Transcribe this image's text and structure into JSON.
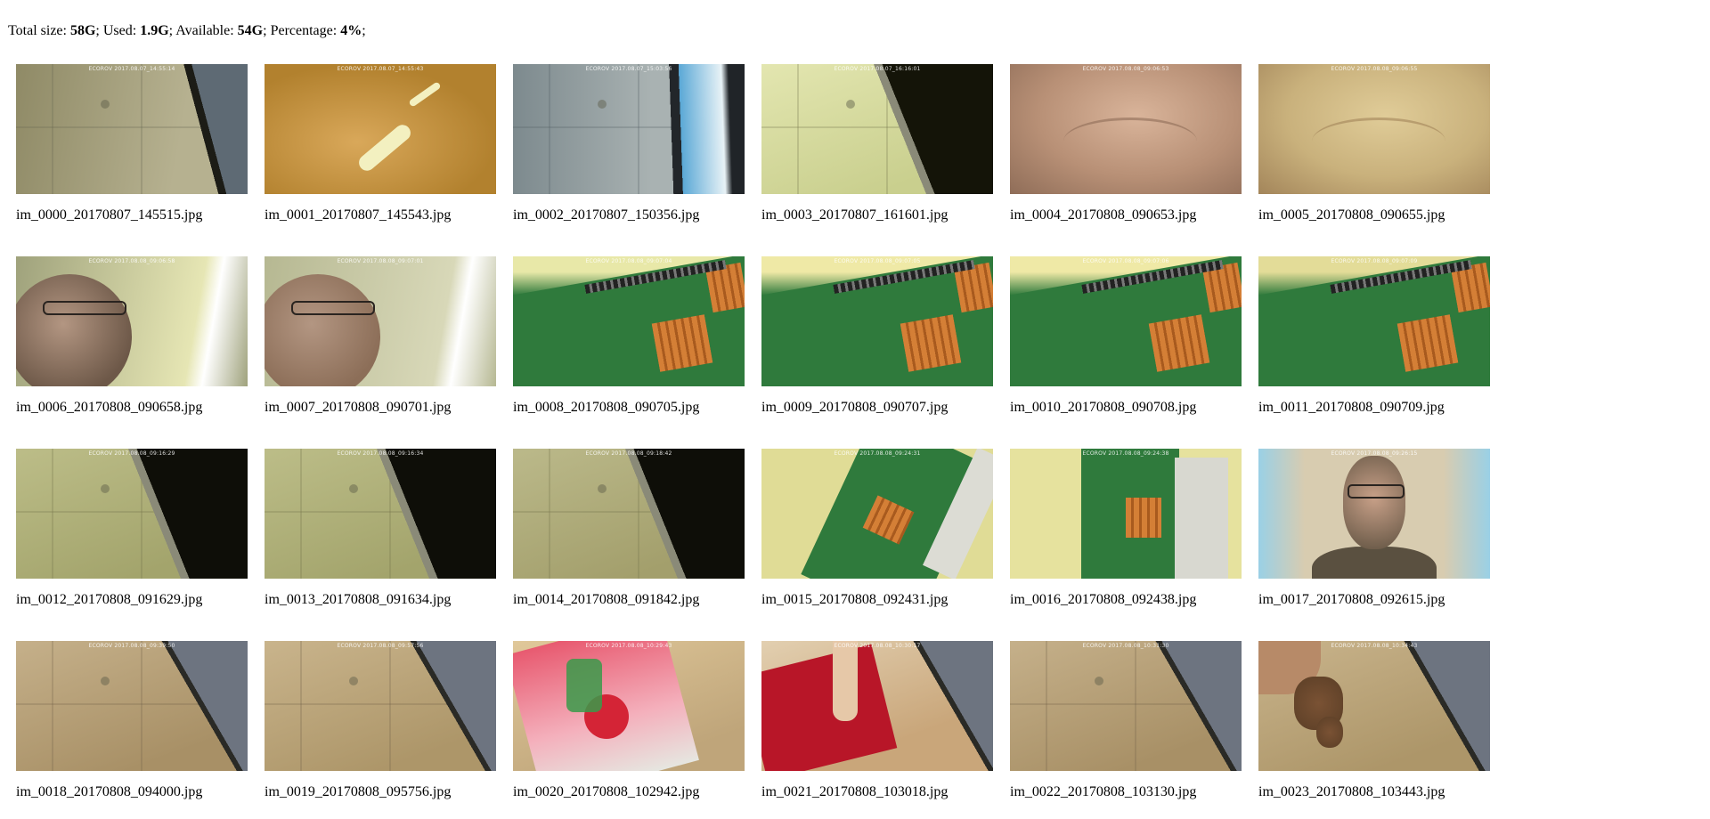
{
  "summary": {
    "total_label": "Total size: ",
    "total_value": "58G",
    "used_label": "; Used: ",
    "used_value": "1.9G",
    "available_label": "; Available: ",
    "available_value": "54G",
    "percentage_label": "; Percentage: ",
    "percentage_value": "4%",
    "end": ";"
  },
  "photos": [
    {
      "file": "im_0000_20170807_145515.jpg",
      "stamp": "ECOROV 2017.08.07_14:55:14",
      "scene": "ceiling-right-dark",
      "colors": [
        "#8f8a66",
        "#b6b190",
        "#5e6a74"
      ]
    },
    {
      "file": "im_0001_20170807_145543.jpg",
      "stamp": "ECOROV 2017.08.07_14:55:43",
      "scene": "hand-light",
      "colors": [
        "#b2812e",
        "#d9a85a",
        "#f3f0c0"
      ]
    },
    {
      "file": "im_0002_20170807_150356.jpg",
      "stamp": "ECOROV 2017.08.07_15:03:56",
      "scene": "ceiling-blue",
      "colors": [
        "#7d8a8e",
        "#a9b2b2",
        "#5aa8d6"
      ]
    },
    {
      "file": "im_0003_20170807_161601.jpg",
      "stamp": "ECOROV 2017.08.07_16:16:01",
      "scene": "ceiling-black-diag",
      "colors": [
        "#c9cf8e",
        "#e3e6b0",
        "#141408"
      ]
    },
    {
      "file": "im_0004_20170808_090653.jpg",
      "stamp": "ECOROV 2017.08.08_09:06:53",
      "scene": "skin",
      "colors": [
        "#b89076",
        "#d9b49a",
        "#8f6d58"
      ]
    },
    {
      "file": "im_0005_20170808_090655.jpg",
      "stamp": "ECOROV 2017.08.08_09:06:55",
      "scene": "skin-yellow",
      "colors": [
        "#c9b17c",
        "#e0cc98",
        "#a3855a"
      ]
    },
    {
      "file": "im_0006_20170808_090658.jpg",
      "stamp": "ECOROV 2017.08.08_09:06:58",
      "scene": "face-left",
      "colors": [
        "#9fa27c",
        "#e6e6b4",
        "#6d5848"
      ]
    },
    {
      "file": "im_0007_20170808_090701.jpg",
      "stamp": "ECOROV 2017.08.08_09:07:01",
      "scene": "face-left",
      "colors": [
        "#b6b892",
        "#d8d8b8",
        "#8c6e58"
      ]
    },
    {
      "file": "im_0008_20170808_090705.jpg",
      "stamp": "ECOROV 2017.08.08_09:07:04",
      "scene": "board",
      "colors": [
        "#2f7a3c",
        "#e8e8a8",
        "#d47f36"
      ]
    },
    {
      "file": "im_0009_20170808_090707.jpg",
      "stamp": "ECOROV 2017.08.08_09:07:05",
      "scene": "board",
      "colors": [
        "#2f7a3c",
        "#efe9a6",
        "#d47f36"
      ]
    },
    {
      "file": "im_0010_20170808_090708.jpg",
      "stamp": "ECOROV 2017.08.08_09:07:06",
      "scene": "board",
      "colors": [
        "#2f7a3c",
        "#efe9a6",
        "#d47f36"
      ]
    },
    {
      "file": "im_0011_20170808_090709.jpg",
      "stamp": "ECOROV 2017.08.08_09:07:09",
      "scene": "board",
      "colors": [
        "#2f7a3c",
        "#e3dc98",
        "#d47f36"
      ]
    },
    {
      "file": "im_0012_20170808_091629.jpg",
      "stamp": "ECOROV 2017.08.08_09:16:29",
      "scene": "ceiling-black-diag",
      "colors": [
        "#a3a46c",
        "#bcbd88",
        "#0e0e08"
      ]
    },
    {
      "file": "im_0013_20170808_091634.jpg",
      "stamp": "ECOROV 2017.08.08_09:16:34",
      "scene": "ceiling-black-diag",
      "colors": [
        "#a3a46c",
        "#bcbd88",
        "#0e0e08"
      ]
    },
    {
      "file": "im_0014_20170808_091842.jpg",
      "stamp": "ECOROV 2017.08.08_09:18:42",
      "scene": "ceiling-black-diag",
      "colors": [
        "#a39f6c",
        "#bbb98a",
        "#0e0e08"
      ]
    },
    {
      "file": "im_0015_20170808_092431.jpg",
      "stamp": "ECOROV 2017.08.08_09:24:31",
      "scene": "board-tilted",
      "colors": [
        "#e0dc96",
        "#2f7a3c",
        "#d47f36"
      ]
    },
    {
      "file": "im_0016_20170808_092438.jpg",
      "stamp": "ECOROV 2017.08.08_09:24:38",
      "scene": "board-vertical",
      "colors": [
        "#e6e29e",
        "#2f7a3c",
        "#d8d8d0"
      ]
    },
    {
      "file": "im_0017_20170808_092615.jpg",
      "stamp": "ECOROV 2017.08.08_09:26:15",
      "scene": "face-center",
      "colors": [
        "#d8ccb0",
        "#9ad0e6",
        "#6a5a48"
      ]
    },
    {
      "file": "im_0018_20170808_094000.jpg",
      "stamp": "ECOROV 2017.08.08_09:39:50",
      "scene": "ceiling-gray-diag",
      "colors": [
        "#a89066",
        "#c5b08a",
        "#6d7480"
      ]
    },
    {
      "file": "im_0019_20170808_095756.jpg",
      "stamp": "ECOROV 2017.08.08_09:57:56",
      "scene": "ceiling-gray-diag",
      "colors": [
        "#ad9669",
        "#c9b48c",
        "#6d7480"
      ]
    },
    {
      "file": "im_0020_20170808_102942.jpg",
      "stamp": "ECOROV 2017.08.08_10:29:43",
      "scene": "mentos",
      "colors": [
        "#e0c89a",
        "#e85a70",
        "#3a9a4a"
      ]
    },
    {
      "file": "im_0021_20170808_103018.jpg",
      "stamp": "ECOROV 2017.08.08_10:30:17",
      "scene": "red-card",
      "colors": [
        "#c9a67a",
        "#b81628",
        "#e6c8a8"
      ]
    },
    {
      "file": "im_0022_20170808_103130.jpg",
      "stamp": "ECOROV 2017.08.08_10:31:30",
      "scene": "ceiling-gray-diag",
      "colors": [
        "#a89066",
        "#c5b08a",
        "#6d7480"
      ]
    },
    {
      "file": "im_0023_20170808_103443.jpg",
      "stamp": "ECOROV 2017.08.08_10:34:43",
      "scene": "hand-object",
      "colors": [
        "#ad9669",
        "#c9b48c",
        "#5a3e26"
      ]
    }
  ]
}
